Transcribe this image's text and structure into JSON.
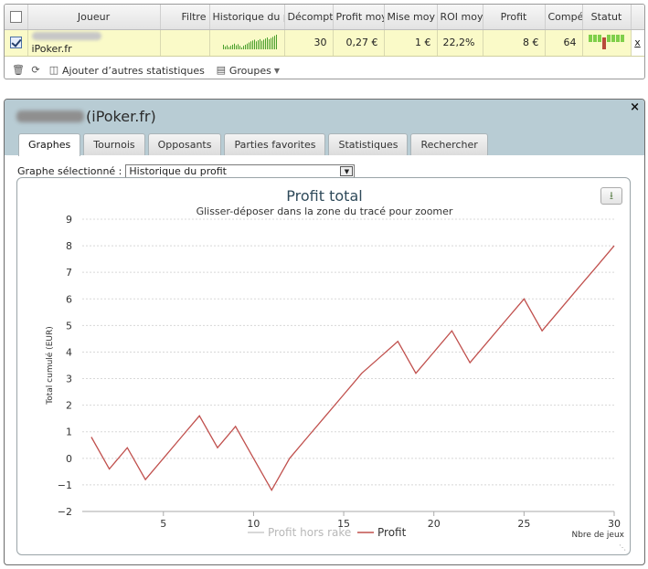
{
  "stats_table": {
    "columns": [
      "",
      "Joueur",
      "Filtre",
      "Historique du p",
      "Décompt",
      "Profit moy",
      "Mise moy",
      "ROI moy",
      "Profit",
      "Compé",
      "Statut",
      ""
    ],
    "row": {
      "checked": true,
      "site": "iPoker.fr",
      "decompte": "30",
      "profit_moyen": "0,27 €",
      "mise_moyenne": "1 €",
      "roi_moyen": "22,2%",
      "profit": "8 €",
      "competence": "64",
      "remove": "x"
    },
    "toolbar": {
      "add_stats": "Ajouter d’autres statistiques",
      "groups": "Groupes"
    }
  },
  "player_panel": {
    "title_suffix": "(iPoker.fr)",
    "close": "×",
    "tabs": [
      "Graphes",
      "Tournois",
      "Opposants",
      "Parties favorites",
      "Statistiques",
      "Rechercher"
    ],
    "active_tab": 0,
    "graph_select": {
      "label": "Graphe sélectionné :",
      "value": "Historique du profit"
    }
  },
  "colors": {
    "profit_line": "#c0504d",
    "rake_line": "#cccccc",
    "legend_inactive": "#b8b8b8",
    "status_green": "#7fcf4a",
    "status_red": "#b84a3a",
    "sparkline": "#4aa02c"
  },
  "chart_data": {
    "type": "line",
    "title": "Profit total",
    "subtitle": "Glisser-déposer dans la zone du tracé pour zoomer",
    "xlabel": "Nbre de jeux",
    "ylabel": "Total cumulé (EUR)",
    "xlim": [
      0.5,
      30
    ],
    "ylim": [
      -2,
      9
    ],
    "x_ticks": [
      5,
      10,
      15,
      20,
      25,
      30
    ],
    "y_ticks": [
      -2,
      -1,
      0,
      1,
      2,
      3,
      4,
      5,
      6,
      7,
      8,
      9
    ],
    "grid": true,
    "legend_placement": "bottom-center",
    "series": [
      {
        "name": "Profit hors rake",
        "visible": false,
        "values": []
      },
      {
        "name": "Profit",
        "visible": true,
        "x": [
          1,
          2,
          3,
          4,
          5,
          6,
          7,
          8,
          9,
          10,
          11,
          12,
          13,
          14,
          15,
          16,
          17,
          18,
          19,
          20,
          21,
          22,
          23,
          24,
          25,
          26,
          27,
          28,
          29,
          30
        ],
        "values": [
          0.8,
          -0.4,
          0.4,
          -0.8,
          -0.0,
          0.8,
          1.6,
          0.4,
          1.2,
          0.0,
          -1.2,
          -0.0,
          0.8,
          1.6,
          2.4,
          3.2,
          3.8,
          4.4,
          3.2,
          4.0,
          4.8,
          3.6,
          4.4,
          5.2,
          6.0,
          4.8,
          5.6,
          6.4,
          7.2,
          8.0
        ]
      }
    ]
  }
}
